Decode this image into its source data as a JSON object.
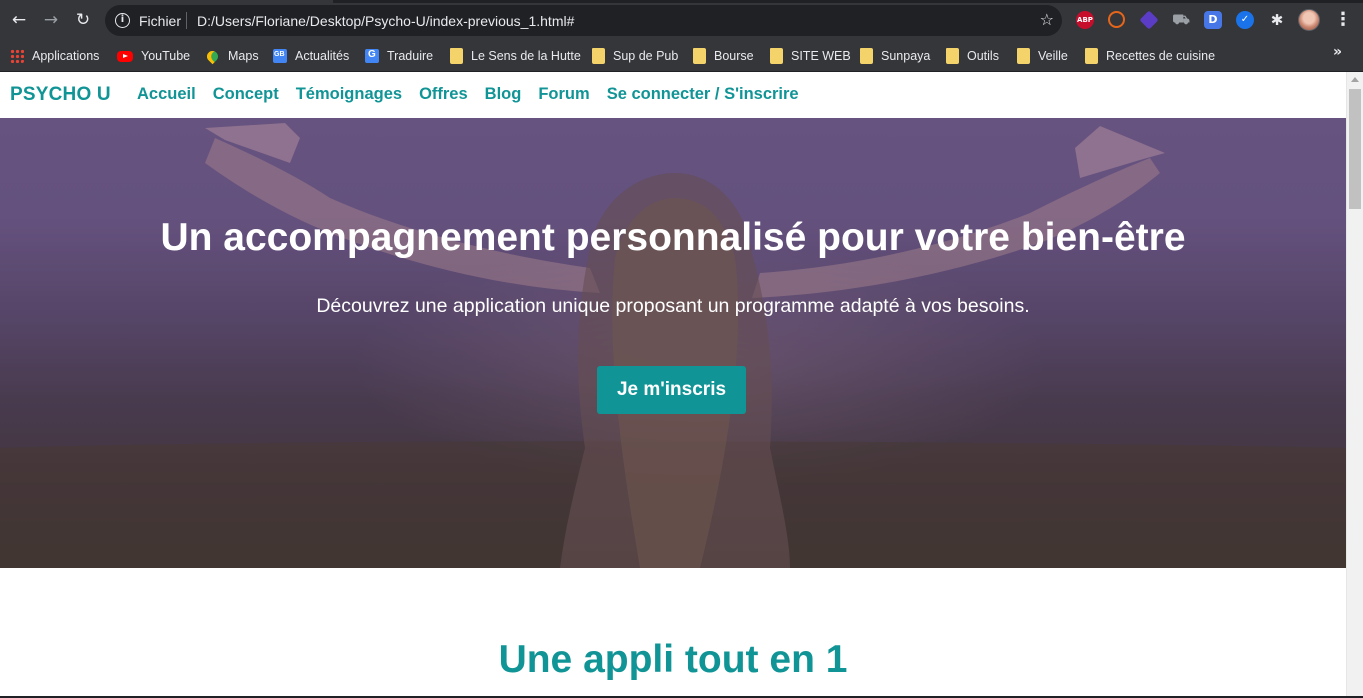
{
  "browser": {
    "scheme_label": "Fichier",
    "url": "D:/Users/Floriane/Desktop/Psycho-U/index-previous_1.html#",
    "icons": {
      "back": "arrow-left-icon",
      "forward": "arrow-right-icon",
      "reload": "reload-icon",
      "info": "info-icon",
      "star": "star-icon",
      "menu": "more-vert-icon"
    },
    "extensions": [
      {
        "name": "adblock-plus-icon",
        "label": "ABP",
        "color": "#c70d2c"
      },
      {
        "name": "orange-ring-extension-icon",
        "label": "",
        "color": "#e5661a"
      },
      {
        "name": "layers-extension-icon",
        "label": "",
        "color": "#5b3cc4"
      },
      {
        "name": "cart-extension-icon",
        "label": "",
        "color": "#9aa0a6"
      },
      {
        "name": "d-extension-icon",
        "label": "D",
        "color": "#4776e6"
      },
      {
        "name": "check-extension-icon",
        "label": "✓",
        "color": "#1a73e8"
      },
      {
        "name": "puzzle-icon",
        "label": "",
        "color": "#e8eaed"
      }
    ]
  },
  "bookmarks": [
    {
      "label": "Applications",
      "icon": "apps-grid-icon"
    },
    {
      "label": "YouTube",
      "icon": "youtube-icon"
    },
    {
      "label": "Maps",
      "icon": "maps-pin-icon"
    },
    {
      "label": "Actualités",
      "icon": "google-news-icon"
    },
    {
      "label": "Traduire",
      "icon": "google-translate-icon"
    },
    {
      "label": "Le Sens de la Hutte",
      "icon": "folder-icon"
    },
    {
      "label": "Sup de Pub",
      "icon": "folder-icon"
    },
    {
      "label": "Bourse",
      "icon": "folder-icon"
    },
    {
      "label": "SITE WEB",
      "icon": "folder-icon"
    },
    {
      "label": "Sunpaya",
      "icon": "folder-icon"
    },
    {
      "label": "Outils",
      "icon": "folder-icon"
    },
    {
      "label": "Veille",
      "icon": "folder-icon"
    },
    {
      "label": "Recettes de cuisine",
      "icon": "folder-icon"
    }
  ],
  "bookmarks_overflow": "»",
  "site": {
    "brand": "PSYCHO U",
    "nav": [
      "Accueil",
      "Concept",
      "Témoignages",
      "Offres",
      "Blog",
      "Forum",
      "Se connecter / S'inscrire"
    ],
    "hero": {
      "title": "Un accompagnement personnalisé pour votre bien-être",
      "subtitle": "Découvrez une application unique proposant un programme adapté à vos besoins.",
      "cta": "Je m'inscris"
    },
    "section_title": "Une appli tout en 1"
  },
  "colors": {
    "accent": "#119496",
    "chrome_bg": "#35363a",
    "omnibox_bg": "#202124"
  }
}
